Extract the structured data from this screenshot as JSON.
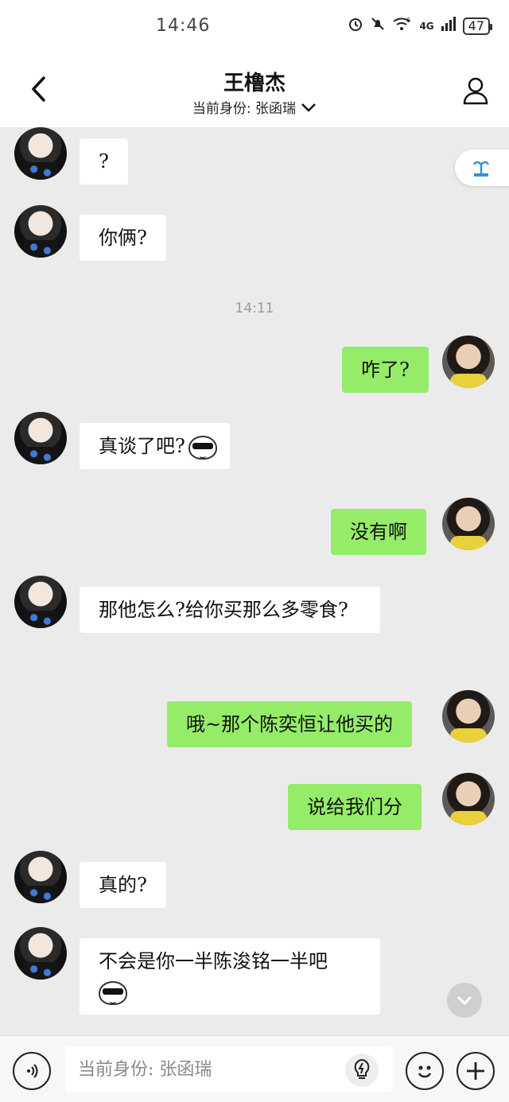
{
  "status_bar": {
    "time": "14:46",
    "network": "4G",
    "wifi_badge": "6",
    "battery": "47"
  },
  "header": {
    "title": "王橹杰",
    "subtitle": "当前身份: 张函瑞"
  },
  "messages": [
    {
      "side": "in",
      "text": "?"
    },
    {
      "side": "in",
      "text": "你俩?"
    },
    {
      "side": "divider",
      "text": "14:11"
    },
    {
      "side": "out",
      "text": "咋了?"
    },
    {
      "side": "in",
      "text": "真谈了吧?",
      "emoji": "sunglasses-emoji"
    },
    {
      "side": "out",
      "text": "没有啊"
    },
    {
      "side": "in",
      "text": "那他怎么?给你买那么多零食?"
    },
    {
      "side": "out",
      "text": "哦~那个陈奕恒让他买的"
    },
    {
      "side": "out",
      "text": "说给我们分"
    },
    {
      "side": "in",
      "text": "真的?"
    },
    {
      "side": "in",
      "text": "不会是你一半陈浚铭一半吧",
      "emoji": "sunglasses-emoji"
    }
  ],
  "input_bar": {
    "placeholder": "当前身份: 张函瑞"
  },
  "icons": {
    "back": "chevron-left-icon",
    "profile": "person-icon",
    "voice": "voice-icon",
    "flash": "lightning-icon",
    "emoji": "smiley-icon",
    "plus": "plus-icon",
    "scroll": "chevron-down-icon"
  },
  "colors": {
    "outgoing_bubble": "#95ec69",
    "incoming_bubble": "#ffffff",
    "chat_background": "#ebebeb"
  }
}
